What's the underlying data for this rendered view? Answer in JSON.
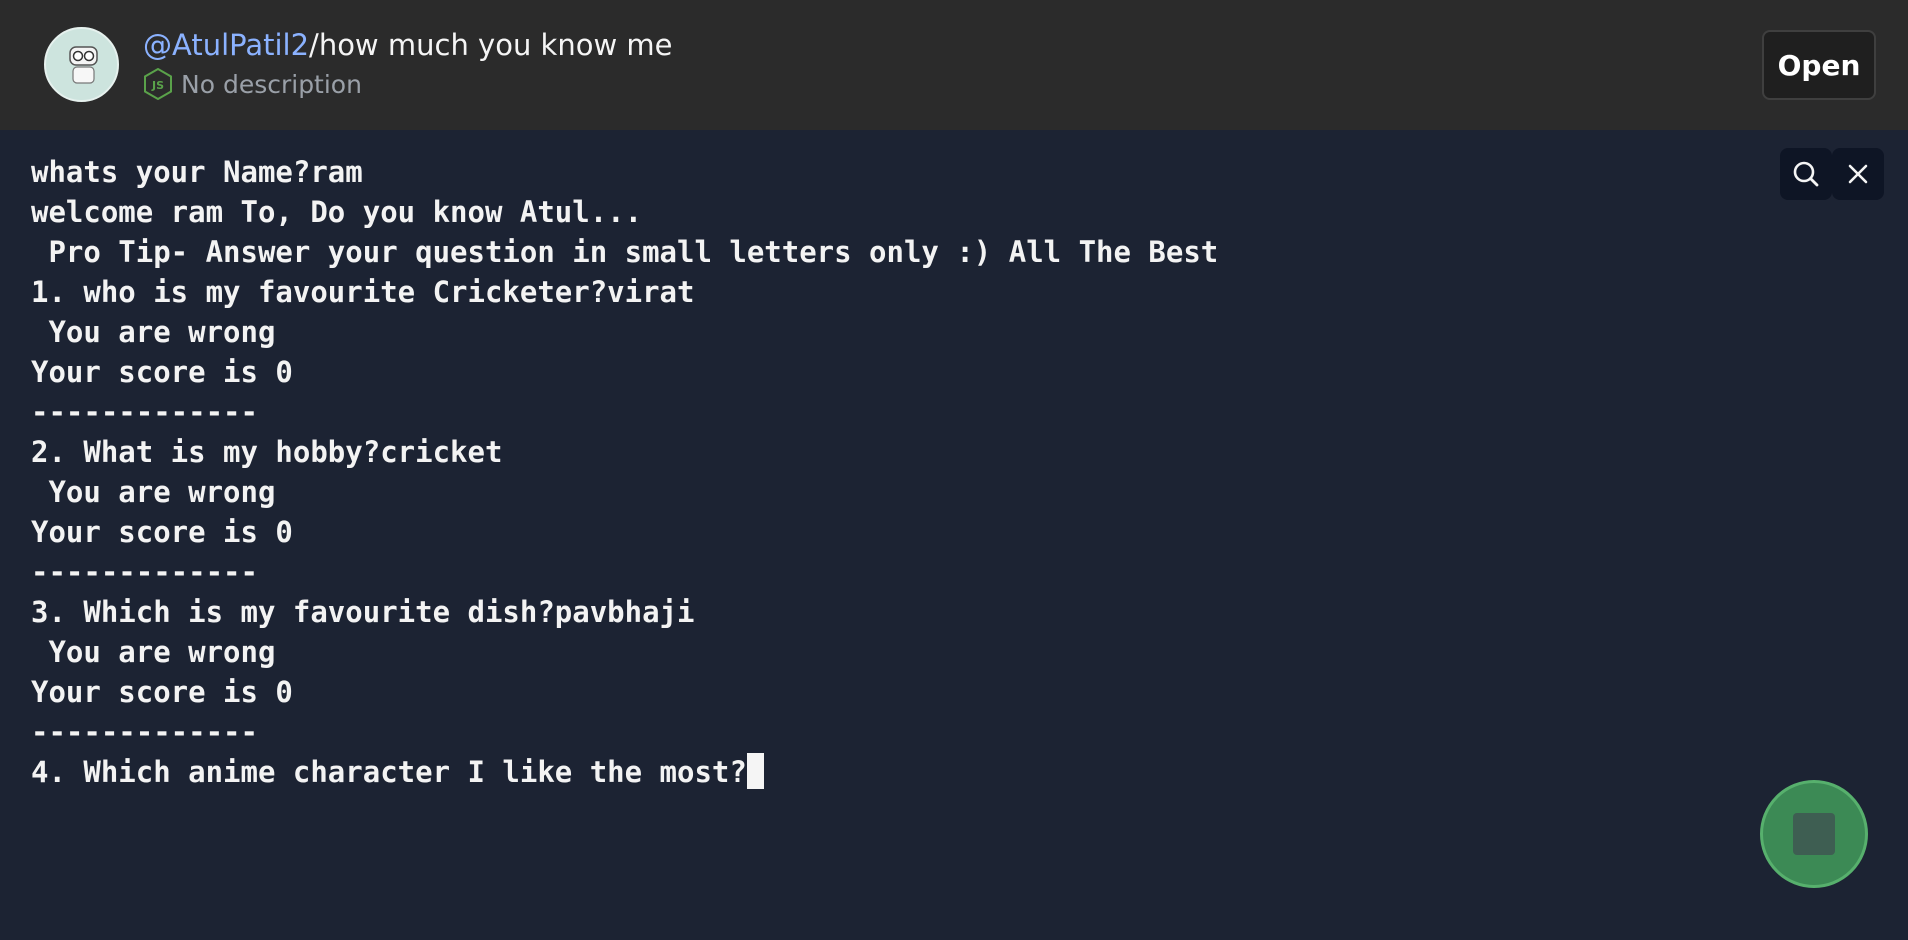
{
  "header": {
    "owner": "@AtulPatil2",
    "separator": "/",
    "repl_name": "how much you know me",
    "language_icon": "nodejs-icon",
    "description": "No description",
    "open_label": "Open"
  },
  "console": {
    "lines": [
      "whats your Name?ram",
      "welcome ram To, Do you know Atul...",
      " Pro Tip- Answer your question in small letters only :) All The Best",
      "1. who is my favourite Cricketer?virat",
      " You are wrong",
      "Your score is 0",
      "-------------",
      "2. What is my hobby?cricket",
      " You are wrong",
      "Your score is 0",
      "-------------",
      "3. Which is my favourite dish?pavbhaji",
      " You are wrong",
      "Your score is 0",
      "-------------",
      "4. Which anime character I like the most?"
    ]
  },
  "controls": {
    "search_icon": "search-icon",
    "close_icon": "close-icon",
    "stop_icon": "stop-icon"
  },
  "colors": {
    "header_bg": "#2b2b2b",
    "console_bg": "#1c2333",
    "owner_link": "#8bb2ff",
    "stop_button": "#3c8a55"
  }
}
